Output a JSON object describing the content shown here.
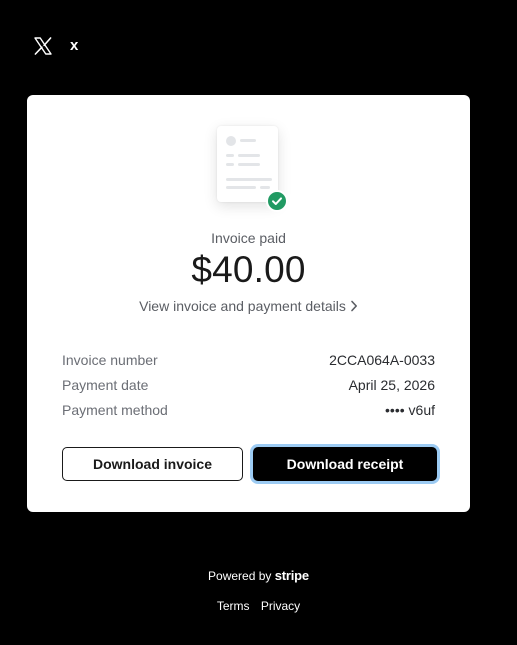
{
  "merchant": {
    "logo_icon": "x-logo-icon",
    "name": "x"
  },
  "invoice": {
    "illustration_icon": "invoice-document-icon",
    "badge_icon": "check-circle-icon",
    "status": "Invoice paid",
    "amount": "$40.00",
    "details_link": "View invoice and payment details",
    "details_link_icon": "chevron-right-icon",
    "rows": [
      {
        "label": "Invoice number",
        "value": "2CCA064A-0033"
      },
      {
        "label": "Payment date",
        "value": "April 25, 2026"
      },
      {
        "label": "Payment method",
        "value": "•••• v6uf"
      }
    ],
    "download_invoice_label": "Download invoice",
    "download_receipt_label": "Download receipt"
  },
  "footer": {
    "powered_by": "Powered by",
    "powered_brand": "stripe",
    "terms_label": "Terms",
    "privacy_label": "Privacy"
  },
  "colors": {
    "background": "#000000",
    "card": "#ffffff",
    "success": "#219a63",
    "focus_ring": "#9ccbf3"
  }
}
